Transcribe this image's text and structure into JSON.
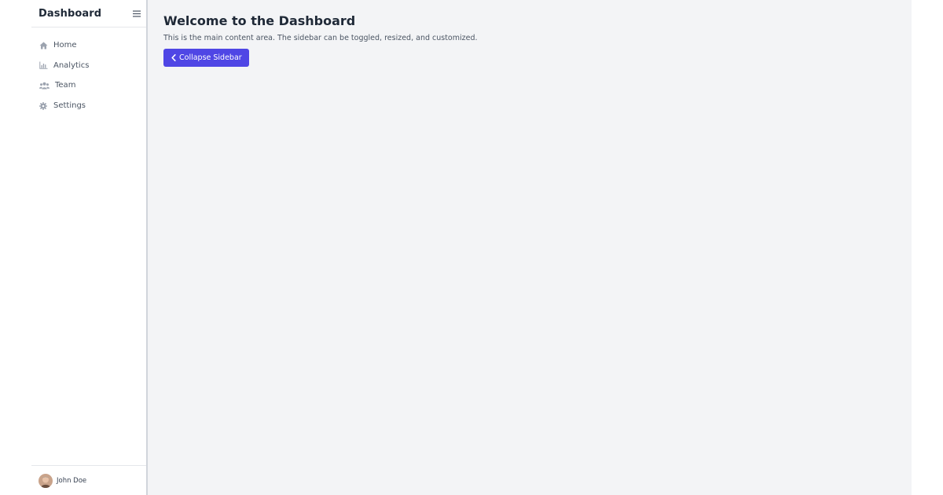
{
  "sidebar": {
    "title": "Dashboard",
    "toggle_icon": "hamburger-menu-icon",
    "items": [
      {
        "label": "Home",
        "icon": "home-icon"
      },
      {
        "label": "Analytics",
        "icon": "chart-icon"
      },
      {
        "label": "Team",
        "icon": "users-icon"
      },
      {
        "label": "Settings",
        "icon": "gear-icon"
      }
    ],
    "user": {
      "name": "John Doe",
      "avatar": "user-avatar"
    }
  },
  "main": {
    "title": "Welcome to the Dashboard",
    "description": "This is the main content area. The sidebar can be toggled, resized, and customized.",
    "collapse_button_label": "Collapse Sidebar",
    "collapse_button_icon": "chevron-left-icon"
  },
  "colors": {
    "accent": "#4f46e5",
    "main_bg": "#f3f4f6",
    "sidebar_bg": "#ffffff",
    "text_dark": "#1f2937",
    "text_muted": "#4b5563",
    "icon_gray": "#9ca3af"
  }
}
